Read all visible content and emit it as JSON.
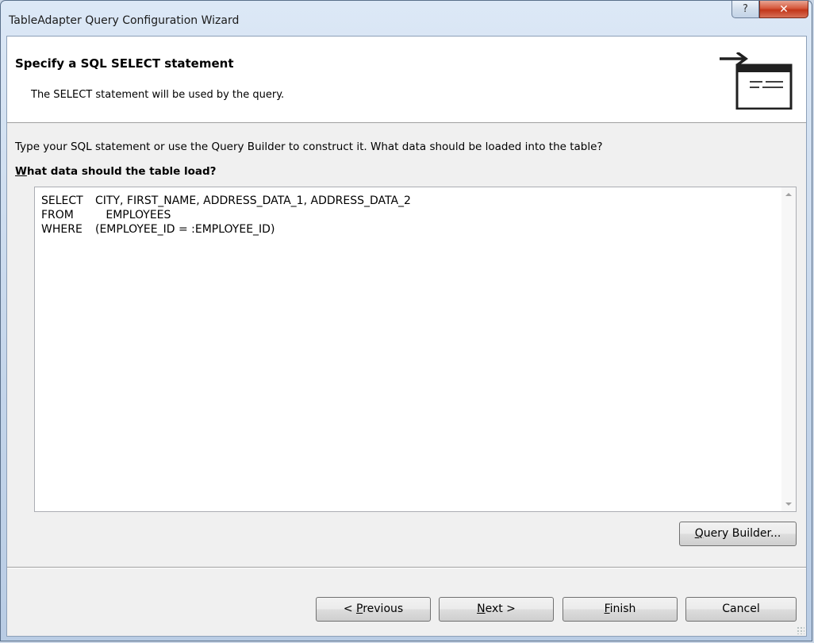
{
  "window": {
    "title": "TableAdapter Query Configuration Wizard",
    "help_symbol": "?",
    "close_symbol": "✕"
  },
  "header": {
    "title": "Specify a SQL SELECT statement",
    "subtitle": "The SELECT statement will be used by the query.",
    "icon": "sql-statement-icon"
  },
  "body": {
    "instructions": "Type your SQL statement or use the Query Builder to construct it. What data should be loaded into the table?",
    "sql_label_mnemonic": "W",
    "sql_label_rest": "hat data should the table load?",
    "sql_lines": [
      {
        "keyword": "SELECT",
        "text": "CITY, FIRST_NAME, ADDRESS_DATA_1, ADDRESS_DATA_2"
      },
      {
        "keyword": "FROM",
        "text": "   EMPLOYEES"
      },
      {
        "keyword": "WHERE",
        "text": "(EMPLOYEE_ID = :EMPLOYEE_ID)"
      }
    ],
    "query_builder": {
      "mnemonic": "Q",
      "rest": "uery Builder..."
    }
  },
  "footer": {
    "previous": {
      "prefix": "< ",
      "mnemonic": "P",
      "rest": "revious"
    },
    "next": {
      "mnemonic": "N",
      "rest": "ext >"
    },
    "finish": {
      "mnemonic": "F",
      "rest": "inish"
    },
    "cancel": "Cancel"
  },
  "colors": {
    "frame": "#c4d5ea",
    "client": "#f0f0f0",
    "close_button": "#c2361a",
    "focus_border": "#3c7fb1"
  }
}
